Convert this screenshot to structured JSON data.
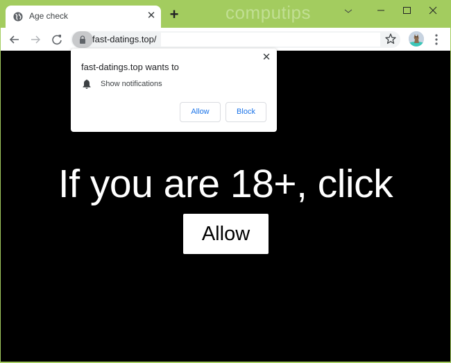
{
  "browser": {
    "tab": {
      "title": "Age check",
      "icon": "globe-icon"
    },
    "new_tab_label": "+",
    "watermark": "computips",
    "window_controls": [
      "tab-search",
      "minimize",
      "maximize",
      "close"
    ],
    "address_bar": {
      "url": "fast-datings.top/",
      "secure_icon": "lock-icon"
    },
    "colors": {
      "frame": "#a3cc5f",
      "link_blue": "#1a73e8"
    }
  },
  "permission_popup": {
    "title": "fast-datings.top wants to",
    "permission": "Show notifications",
    "permission_icon": "bell-icon",
    "allow_label": "Allow",
    "block_label": "Block",
    "close_label": "×"
  },
  "page": {
    "headline": "If you are 18+, click",
    "allow_button_label": "Allow"
  }
}
